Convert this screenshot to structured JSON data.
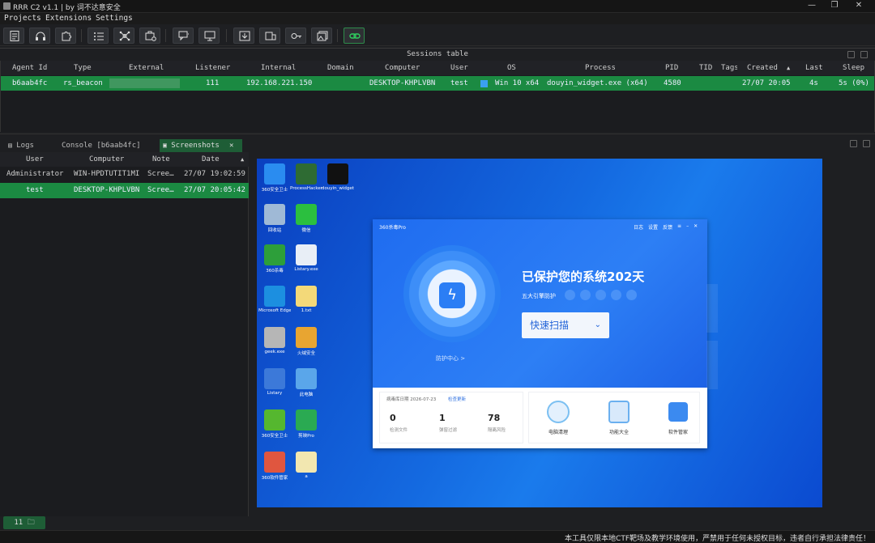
{
  "window": {
    "title": "RRR C2 v1.1 | by 词不达意安全"
  },
  "menu": [
    "Projects",
    "Extensions",
    "Settings"
  ],
  "sessions": {
    "panel_title": "Sessions table",
    "columns": [
      "Agent Id",
      "Type",
      "External",
      "Listener",
      "Internal",
      "Domain",
      "Computer",
      "User",
      "OS",
      "Process",
      "PID",
      "TID",
      "Tags",
      "Created",
      "Last",
      "Sleep"
    ],
    "rows": [
      {
        "agent_id": "b6aab4fc",
        "type": "rs_beacon",
        "external": "",
        "listener": "111",
        "internal": "192.168.221.150",
        "domain": "",
        "computer": "DESKTOP-KHPLVBN",
        "user": "test",
        "os": "Win 10 x64",
        "process": "douyin_widget.exe (x64)",
        "pid": "4580",
        "tid": "",
        "tags": "",
        "created": "27/07 20:05",
        "last": "4s",
        "sleep": "5s (0%)"
      }
    ]
  },
  "tabs": [
    {
      "label": "Logs"
    },
    {
      "label": "Console [b6aab4fc]"
    },
    {
      "label": "Screenshots",
      "active": true
    }
  ],
  "screenshots": {
    "columns": [
      "User",
      "Computer",
      "Note",
      "Date"
    ],
    "rows": [
      {
        "user": "Administrator",
        "computer": "WIN-HPDTUTIT1MI",
        "note": "Scree…",
        "date": "27/07 19:02:59",
        "selected": false
      },
      {
        "user": "test",
        "computer": "DESKTOP-KHPLVBN",
        "note": "Scree…",
        "date": "27/07 20:05:42",
        "selected": true
      }
    ]
  },
  "desktop": {
    "icons": [
      {
        "label": "360安全卫士",
        "color": "#2a8cf0"
      },
      {
        "label": "ProcessHacker",
        "color": "#2e6b33"
      },
      {
        "label": "douyin_widget.exe",
        "color": "#111111"
      },
      {
        "label": "回收站",
        "color": "#9fb9d6"
      },
      {
        "label": "微信",
        "color": "#2bbf3f"
      },
      {
        "label": "360杀毒",
        "color": "#2d9f3a"
      },
      {
        "label": "Listary.exe",
        "color": "#e8eef6"
      },
      {
        "label": "Microsoft Edge",
        "color": "#1c8fe0"
      },
      {
        "label": "1.txt",
        "color": "#f3d979"
      },
      {
        "label": "geek.exe",
        "color": "#b6b6b6"
      },
      {
        "label": "火绒安全",
        "color": "#e8a531"
      },
      {
        "label": "Listary",
        "color": "#3c79d9"
      },
      {
        "label": "此电脑",
        "color": "#5aa6ea"
      },
      {
        "label": "360安全卫士",
        "color": "#55b72f"
      },
      {
        "label": "剪映Pro",
        "color": "#2aaa52"
      },
      {
        "label": "360软件管家",
        "color": "#e0563f"
      },
      {
        "label": "a",
        "color": "#f2e7b0"
      }
    ]
  },
  "antivirus": {
    "app_name": "360杀毒Pro",
    "header_links": [
      "日志",
      "设置",
      "反馈"
    ],
    "headline": "已保护您的系统202天",
    "engines_label": "五大引擎防护",
    "scan_button": "快速扫描",
    "protection_center": "防护中心 >",
    "db_date_label": "病毒库日期 2026-07-23",
    "update_link": "检查更新",
    "stats": [
      {
        "value": "0",
        "label": "检测文件"
      },
      {
        "value": "1",
        "label": "弹窗过滤"
      },
      {
        "value": "78",
        "label": "隔离风险"
      }
    ],
    "tools": [
      "电脑清理",
      "功能大全",
      "软件管家"
    ]
  },
  "footer": {
    "count": "11",
    "notice": "本工具仅限本地CTF靶场及教学环境使用，严禁用于任何未授权目标，违者自行承担法律责任！"
  },
  "colors": {
    "accent": "#1b8a42",
    "tab_active": "#1e5d36"
  }
}
